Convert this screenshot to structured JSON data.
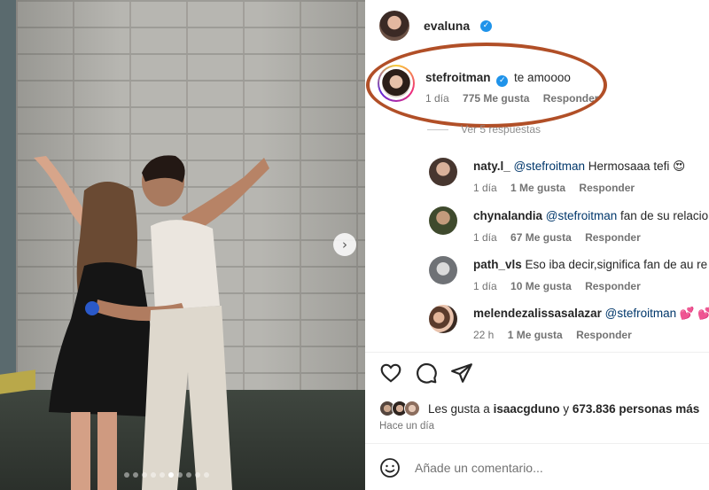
{
  "post": {
    "owner": "evaluna",
    "verified": true
  },
  "comments": [
    {
      "username": "stefroitman",
      "verified": true,
      "text": "te amoooo",
      "time": "1 día",
      "likes": "775 Me gusta",
      "reply": "Responder",
      "view_replies": "Ver 5 respuestas"
    }
  ],
  "replies": [
    {
      "username": "naty.l_",
      "mention": "@stefroitman",
      "text": "Hermosaaa tefi",
      "emoji": "😍",
      "time": "1 día",
      "likes": "1 Me gusta",
      "reply": "Responder"
    },
    {
      "username": "chynalandia",
      "mention": "@stefroitman",
      "text": "fan de su relacio",
      "emoji": "",
      "time": "1 día",
      "likes": "67 Me gusta",
      "reply": "Responder"
    },
    {
      "username": "path_vls",
      "mention": "",
      "text": "Eso iba decir,significa fan de au re",
      "emoji": "",
      "time": "1 día",
      "likes": "10 Me gusta",
      "reply": "Responder"
    },
    {
      "username": "melendezalissasalazar",
      "mention": "@stefroitman",
      "text": "",
      "emoji": "💕 💕",
      "time": "22 h",
      "likes": "1 Me gusta",
      "reply": "Responder"
    }
  ],
  "likes_summary": {
    "prefix": "Les gusta a",
    "user": "isaacgduno",
    "conjunction": "y",
    "others": "673.836 personas más"
  },
  "post_time": "Hace un día",
  "add_comment": {
    "placeholder": "Añade un comentario..."
  },
  "colors": {
    "highlight": "#b14f27",
    "verified": "#1f93ea",
    "mention": "#00376b"
  },
  "icons": [
    "heart-icon",
    "comment-icon",
    "share-icon",
    "emoji-icon",
    "chevron-right-icon",
    "verified-icon"
  ]
}
